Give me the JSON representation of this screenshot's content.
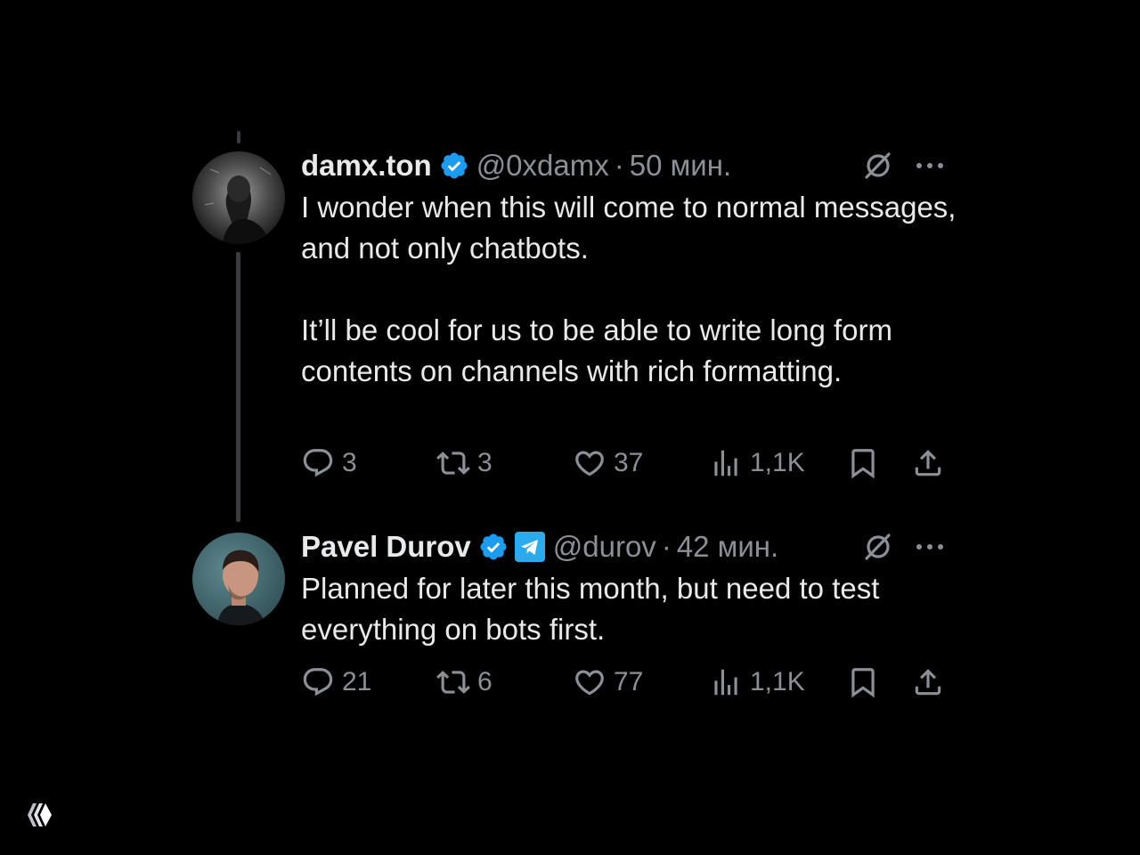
{
  "tweets": [
    {
      "name": "damx.ton",
      "handle": "@0xdamx",
      "separator": "·",
      "time": "50 мин.",
      "paragraphs": [
        "I wonder when this will come to normal messages, and not only chatbots.",
        "It’ll be cool for us to be able to write long form contents on channels with rich formatting."
      ],
      "stats": {
        "replies": "3",
        "reposts": "3",
        "likes": "37",
        "views": "1,1K"
      }
    },
    {
      "name": "Pavel Durov",
      "handle": "@durov",
      "separator": "·",
      "time": "42 мин.",
      "paragraphs": [
        "Planned for later this month, but need to test everything on bots first."
      ],
      "stats": {
        "replies": "21",
        "reposts": "6",
        "likes": "77",
        "views": "1,1K"
      }
    }
  ],
  "icons": {
    "verified": "verified-badge-icon",
    "telegram": "telegram-badge-icon",
    "grok": "grok-icon",
    "more": "more-options-icon",
    "reply": "reply-icon",
    "repost": "repost-icon",
    "like": "heart-icon",
    "views": "views-chart-icon",
    "bookmark": "bookmark-icon",
    "share": "share-icon",
    "corner_logo": "logo-icon"
  },
  "colors": {
    "background": "#000000",
    "text": "#e7e9ea",
    "muted": "#8b9096",
    "verified": "#1d9bf0",
    "telegram": "#2aabee",
    "thread_line": "#3a3d40"
  }
}
